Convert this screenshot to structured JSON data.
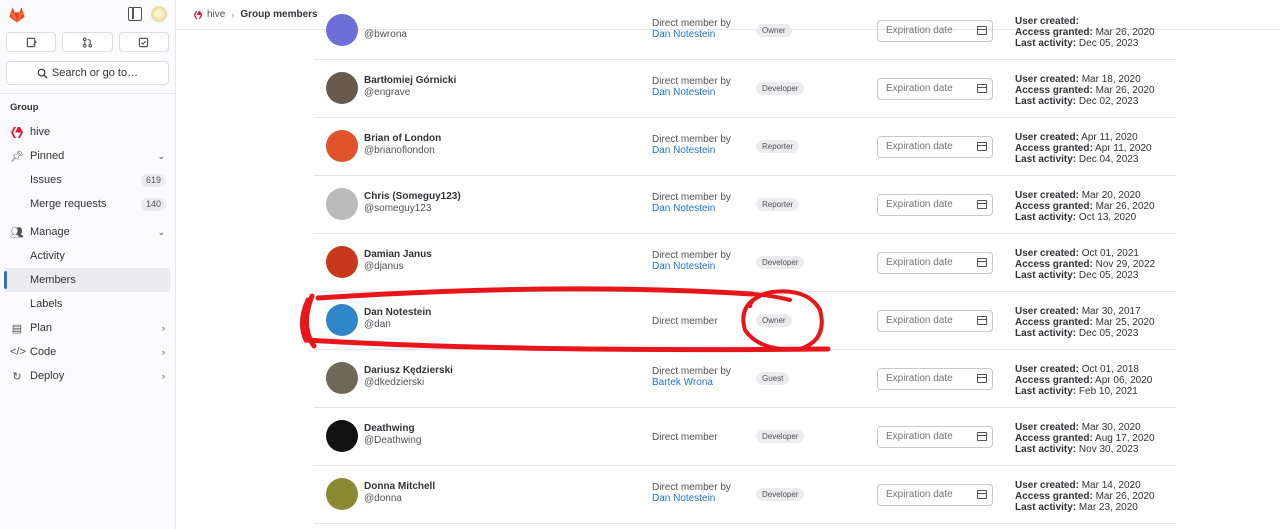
{
  "sidebar": {
    "section_label": "Group",
    "search_label": "Search or go to…",
    "group_name": "hive",
    "pinned_label": "Pinned",
    "issues_label": "Issues",
    "issues_count": "619",
    "merge_requests_label": "Merge requests",
    "merge_requests_count": "140",
    "manage_label": "Manage",
    "activity_label": "Activity",
    "members_label": "Members",
    "labels_label": "Labels",
    "plan_label": "Plan",
    "code_label": "Code",
    "deploy_label": "Deploy"
  },
  "breadcrumb": {
    "group": "hive",
    "current": "Group members"
  },
  "labels": {
    "direct_member_by": "Direct member by",
    "direct_member": "Direct member",
    "expiration_placeholder": "Expiration date",
    "user_created": "User created:",
    "access_granted": "Access granted:",
    "last_activity": "Last activity:"
  },
  "members": [
    {
      "name": "",
      "username": "@bwrona",
      "source_by": "Dan Notestein",
      "role": "Owner",
      "created": "",
      "granted": "Mar 26, 2020",
      "activity": "Dec 05, 2023",
      "avatar_color": "#6b6fd6"
    },
    {
      "name": "Bartłomiej Górnicki",
      "username": "@engrave",
      "source_by": "Dan Notestein",
      "role": "Developer",
      "created": "Mar 18, 2020",
      "granted": "Mar 26, 2020",
      "activity": "Dec 02, 2023",
      "avatar_color": "#6a5a4e"
    },
    {
      "name": "Brian of London",
      "username": "@brianoflondon",
      "source_by": "Dan Notestein",
      "role": "Reporter",
      "created": "Apr 11, 2020",
      "granted": "Apr 11, 2020",
      "activity": "Dec 04, 2023",
      "avatar_color": "#e0522b"
    },
    {
      "name": "Chris (Someguy123)",
      "username": "@someguy123",
      "source_by": "Dan Notestein",
      "role": "Reporter",
      "created": "Mar 20, 2020",
      "granted": "Mar 26, 2020",
      "activity": "Oct 13, 2020",
      "avatar_color": "#bbbbbb"
    },
    {
      "name": "Damian Janus",
      "username": "@djanus",
      "source_by": "Dan Notestein",
      "role": "Developer",
      "created": "Oct 01, 2021",
      "granted": "Nov 29, 2022",
      "activity": "Dec 05, 2023",
      "avatar_color": "#c9381a"
    },
    {
      "name": "Dan Notestein",
      "username": "@dan",
      "source_by": "",
      "role": "Owner",
      "created": "Mar 30, 2017",
      "granted": "Mar 25, 2020",
      "activity": "Dec 05, 2023",
      "avatar_color": "#2e86c9"
    },
    {
      "name": "Dariusz Kędzierski",
      "username": "@dkedzierski",
      "source_by": "Bartek Wrona",
      "role": "Guest",
      "created": "Oct 01, 2018",
      "granted": "Apr 06, 2020",
      "activity": "Feb 10, 2021",
      "avatar_color": "#6f6757"
    },
    {
      "name": "Deathwing",
      "username": "@Deathwing",
      "source_by": "",
      "role": "Developer",
      "created": "Mar 30, 2020",
      "granted": "Aug 17, 2020",
      "activity": "Nov 30, 2023",
      "avatar_color": "#111111"
    },
    {
      "name": "Donna Mitchell",
      "username": "@donna",
      "source_by": "Dan Notestein",
      "role": "Developer",
      "created": "Mar 14, 2020",
      "granted": "Mar 26, 2020",
      "activity": "Mar 23, 2020",
      "avatar_color": "#8a8a35"
    }
  ]
}
